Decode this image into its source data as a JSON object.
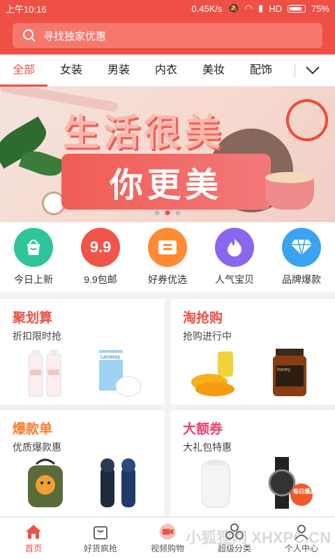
{
  "status": {
    "time": "上午10:16",
    "speed": "0.45K/s",
    "network": "HD",
    "battery": "75%"
  },
  "search": {
    "placeholder": "寻找独家优惠"
  },
  "tabs": [
    "全部",
    "女装",
    "男装",
    "内衣",
    "美妆",
    "配饰"
  ],
  "banner": {
    "headline": "生活很美",
    "subline": "你更美",
    "active_slide": 2,
    "slides": 3
  },
  "icons": [
    {
      "label": "今日上新",
      "icon": "shopping-bag-icon",
      "color": "#2fc59a"
    },
    {
      "label": "9.9包邮",
      "icon": "nine-nine-icon",
      "color": "#f0544a"
    },
    {
      "label": "好券优选",
      "icon": "coupon-icon",
      "color": "#ff8a33"
    },
    {
      "label": "人气宝贝",
      "icon": "flame-icon",
      "color": "#8b66ee"
    },
    {
      "label": "品牌爆款",
      "icon": "diamond-icon",
      "color": "#3aa3f2"
    }
  ],
  "cards": [
    {
      "title": "聚划算",
      "subtitle": "折扣限时抢",
      "color": "#ef5046"
    },
    {
      "title": "淘抢购",
      "subtitle": "抢购进行中",
      "color": "#ef5046"
    },
    {
      "title": "爆款单",
      "subtitle": "优质爆款惠",
      "color": "#ff7a2f"
    },
    {
      "title": "大额券",
      "subtitle": "大礼包特惠",
      "color": "#ef3e6c"
    }
  ],
  "product_labels": {
    "milk": "Lactasoy",
    "honey": "honey",
    "badge": "每日爆品"
  },
  "nav": [
    {
      "label": "首页",
      "icon": "home-icon",
      "active": true
    },
    {
      "label": "好货疯抢",
      "icon": "bag-icon",
      "active": false
    },
    {
      "label": "视频购物",
      "icon": "video-icon",
      "active": false
    },
    {
      "label": "超级分类",
      "icon": "category-icon",
      "active": false
    },
    {
      "label": "个人中心",
      "icon": "user-icon",
      "active": false
    }
  ],
  "watermark": "小狐狸网 XHXPC.CN"
}
